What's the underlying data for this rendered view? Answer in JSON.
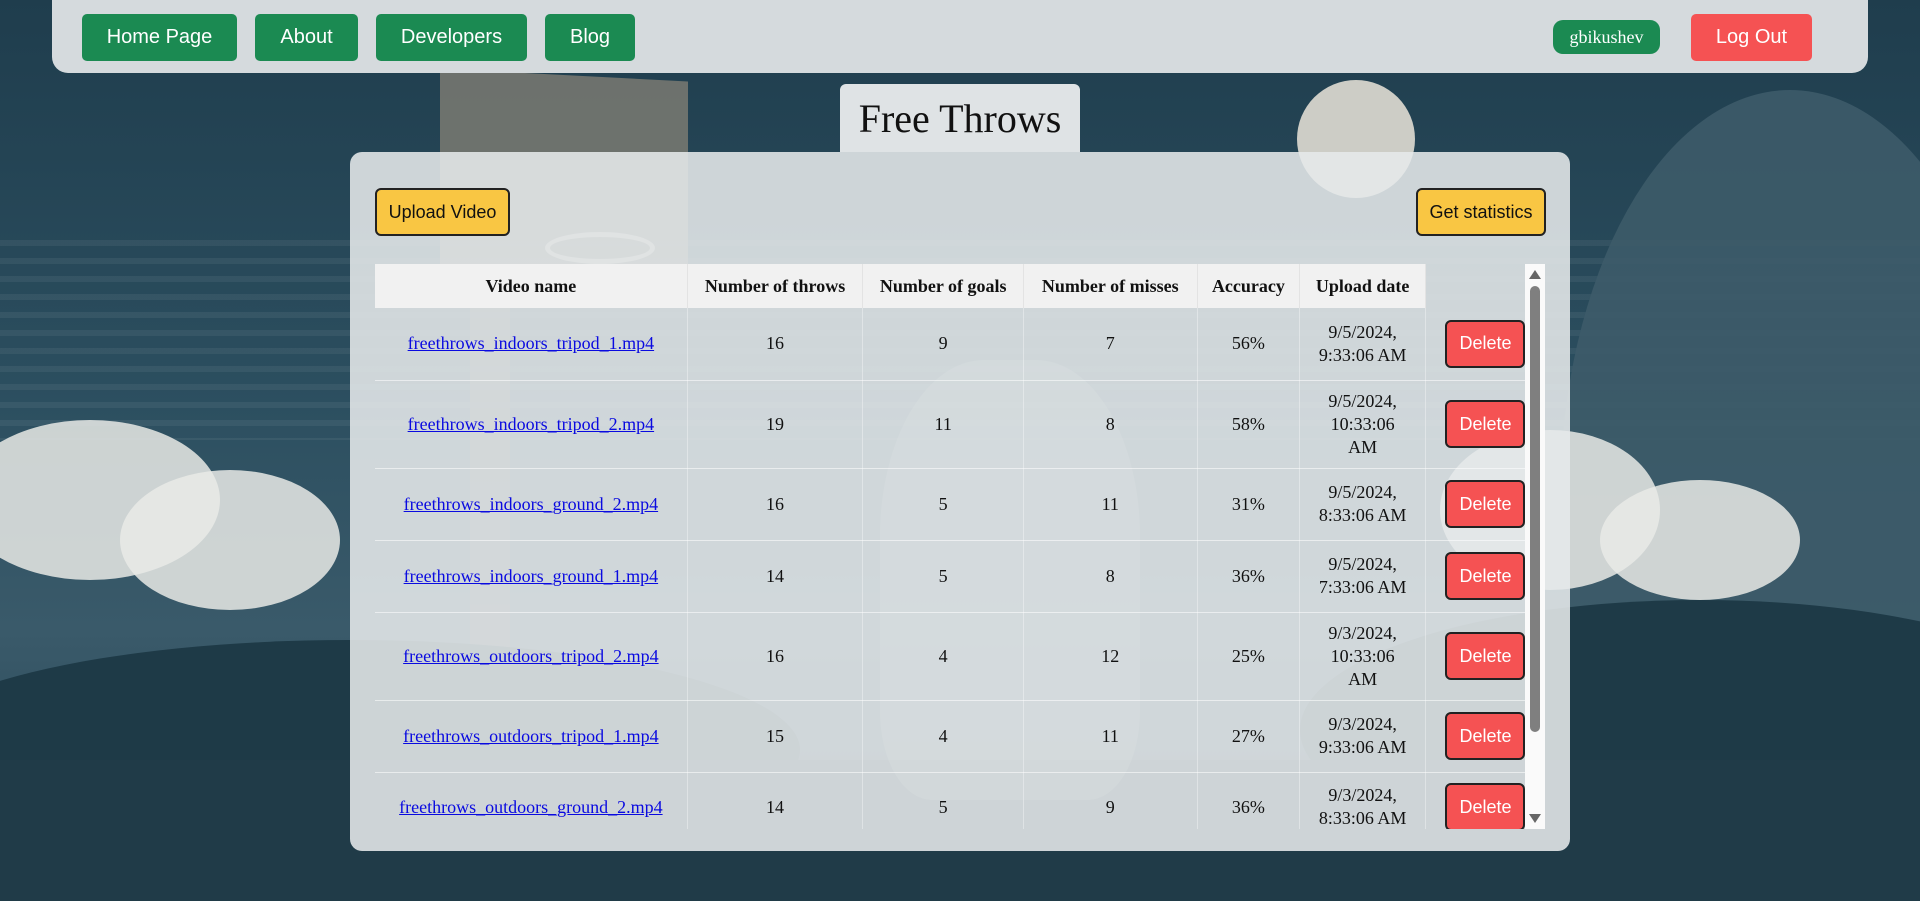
{
  "nav": {
    "home_label": "Home Page",
    "about_label": "About",
    "developers_label": "Developers",
    "blog_label": "Blog",
    "username": "gbikushev",
    "logout_label": "Log Out"
  },
  "page_title": "Free Throws",
  "toolbar": {
    "upload_label": "Upload Video",
    "stats_label": "Get statistics"
  },
  "table": {
    "headers": [
      "Video name",
      "Number of throws",
      "Number of goals",
      "Number of misses",
      "Accuracy",
      "Upload date"
    ],
    "delete_label": "Delete",
    "rows": [
      {
        "name": "freethrows_indoors_tripod_1.mp4",
        "throws": "16",
        "goals": "9",
        "misses": "7",
        "accuracy": "56%",
        "date_line1": "9/5/2024,",
        "date_line2": "9:33:06 AM",
        "date_line3": ""
      },
      {
        "name": "freethrows_indoors_tripod_2.mp4",
        "throws": "19",
        "goals": "11",
        "misses": "8",
        "accuracy": "58%",
        "date_line1": "9/5/2024,",
        "date_line2": "10:33:06",
        "date_line3": "AM"
      },
      {
        "name": "freethrows_indoors_ground_2.mp4",
        "throws": "16",
        "goals": "5",
        "misses": "11",
        "accuracy": "31%",
        "date_line1": "9/5/2024,",
        "date_line2": "8:33:06 AM",
        "date_line3": ""
      },
      {
        "name": "freethrows_indoors_ground_1.mp4",
        "throws": "14",
        "goals": "5",
        "misses": "8",
        "accuracy": "36%",
        "date_line1": "9/5/2024,",
        "date_line2": "7:33:06 AM",
        "date_line3": ""
      },
      {
        "name": "freethrows_outdoors_tripod_2.mp4",
        "throws": "16",
        "goals": "4",
        "misses": "12",
        "accuracy": "25%",
        "date_line1": "9/3/2024,",
        "date_line2": "10:33:06",
        "date_line3": "AM"
      },
      {
        "name": "freethrows_outdoors_tripod_1.mp4",
        "throws": "15",
        "goals": "4",
        "misses": "11",
        "accuracy": "27%",
        "date_line1": "9/3/2024,",
        "date_line2": "9:33:06 AM",
        "date_line3": ""
      },
      {
        "name": "freethrows_outdoors_ground_2.mp4",
        "throws": "14",
        "goals": "5",
        "misses": "9",
        "accuracy": "36%",
        "date_line1": "9/3/2024,",
        "date_line2": "8:33:06 AM",
        "date_line3": ""
      }
    ]
  },
  "colors": {
    "nav_green": "#1b8a52",
    "logout_red": "#f55253",
    "action_yellow": "#f9c643",
    "link_blue": "#0a0ae0"
  }
}
